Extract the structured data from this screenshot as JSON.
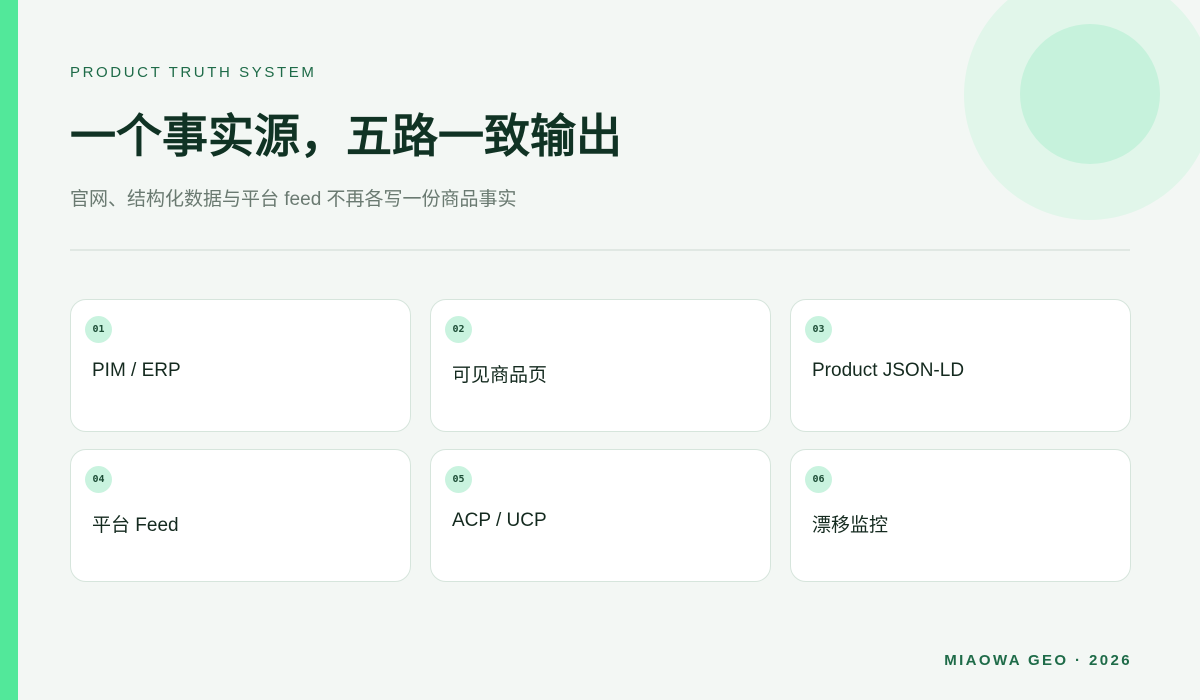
{
  "header": {
    "eyebrow": "PRODUCT TRUTH SYSTEM",
    "title": "一个事实源，五路一致输出",
    "subtitle": "官网、结构化数据与平台 feed 不再各写一份商品事实"
  },
  "cards": [
    {
      "number": "01",
      "label": "PIM / ERP"
    },
    {
      "number": "02",
      "label": "可见商品页"
    },
    {
      "number": "03",
      "label": "Product JSON-LD"
    },
    {
      "number": "04",
      "label": "平台 Feed"
    },
    {
      "number": "05",
      "label": "ACP / UCP"
    },
    {
      "number": "06",
      "label": "漂移监控"
    }
  ],
  "footer": {
    "text": "MIAOWA GEO · 2026"
  },
  "colors": {
    "accent": "#52e89a",
    "badge": "#c9f3df",
    "title": "#103324",
    "eyebrow": "#1e6b48",
    "background": "#f3f7f4"
  }
}
